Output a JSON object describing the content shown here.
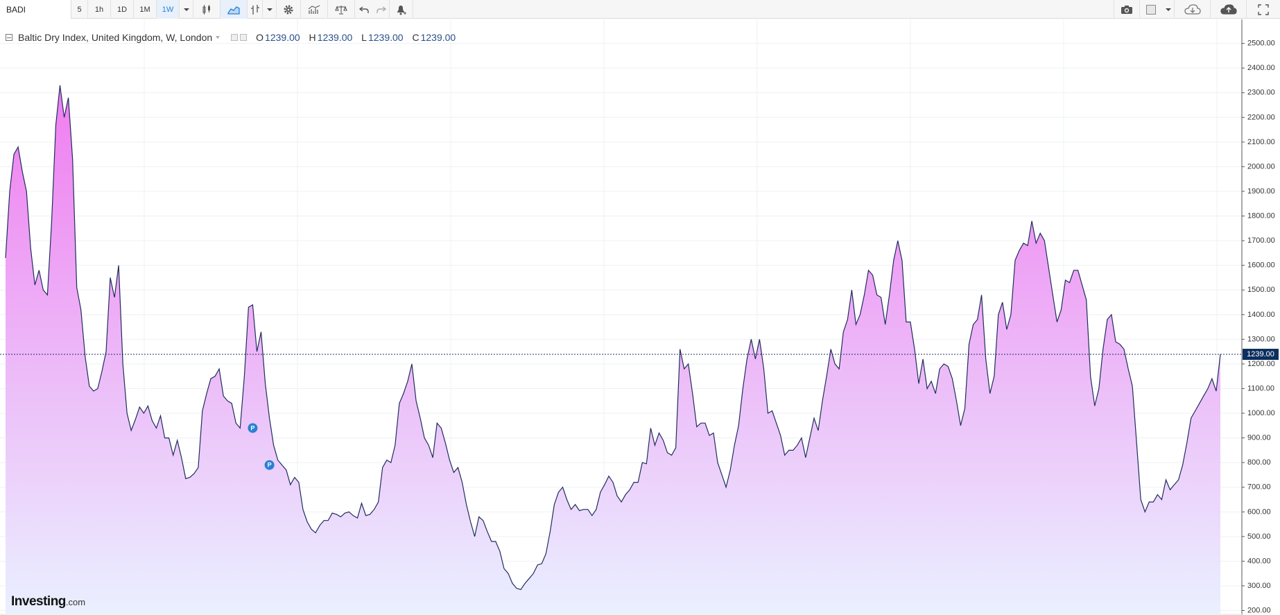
{
  "toolbar": {
    "symbol": "BADI",
    "intervals": [
      "5",
      "1h",
      "1D",
      "1M",
      "1W"
    ],
    "active_interval": "1W"
  },
  "legend": {
    "title": "Baltic Dry Index, United Kingdom, W, London",
    "open_label": "O",
    "open": "1239.00",
    "high_label": "H",
    "high": "1239.00",
    "low_label": "L",
    "low": "1239.00",
    "close_label": "C",
    "close": "1239.00"
  },
  "price_axis": {
    "last_price_label": "1239.00",
    "last_price_color": "#0d2f5f"
  },
  "branding": {
    "logo_main": "Investing",
    "logo_domain": ".com"
  },
  "colors": {
    "line": "#1f2d5c",
    "fill_top": "#f07cf0",
    "fill_bottom": "#eaf0ff",
    "accent": "#2a7fd4"
  },
  "chart_data": {
    "type": "area",
    "ylim": [
      200,
      2550
    ],
    "yticks": [
      200,
      300,
      400,
      500,
      600,
      700,
      800,
      900,
      1000,
      1100,
      1200,
      1300,
      1400,
      1500,
      1600,
      1700,
      1800,
      1900,
      2000,
      2100,
      2200,
      2300,
      2400,
      2500
    ],
    "last_value": 1239,
    "markers": [
      {
        "label": "P",
        "index": 59,
        "value": 940
      },
      {
        "label": "P",
        "index": 63,
        "value": 790
      }
    ],
    "values": [
      1630,
      1900,
      2050,
      2080,
      1980,
      1900,
      1670,
      1520,
      1580,
      1500,
      1480,
      1780,
      2170,
      2330,
      2200,
      2280,
      2030,
      1510,
      1420,
      1230,
      1110,
      1090,
      1100,
      1170,
      1250,
      1550,
      1470,
      1600,
      1200,
      1000,
      930,
      975,
      1025,
      1000,
      1030,
      970,
      940,
      990,
      900,
      900,
      830,
      890,
      820,
      735,
      740,
      755,
      780,
      1010,
      1080,
      1140,
      1150,
      1180,
      1070,
      1050,
      1040,
      960,
      940,
      1150,
      1430,
      1440,
      1250,
      1330,
      1120,
      980,
      870,
      810,
      790,
      770,
      710,
      740,
      720,
      610,
      560,
      530,
      515,
      545,
      565,
      565,
      595,
      590,
      580,
      595,
      600,
      585,
      575,
      635,
      585,
      590,
      610,
      640,
      780,
      810,
      800,
      870,
      1040,
      1080,
      1130,
      1200,
      1050,
      980,
      900,
      870,
      820,
      960,
      940,
      880,
      810,
      760,
      780,
      720,
      630,
      560,
      500,
      580,
      565,
      520,
      480,
      480,
      440,
      370,
      350,
      310,
      290,
      285,
      310,
      330,
      350,
      385,
      390,
      430,
      520,
      630,
      680,
      700,
      650,
      610,
      630,
      605,
      610,
      610,
      585,
      610,
      680,
      710,
      745,
      720,
      665,
      640,
      670,
      690,
      720,
      720,
      800,
      795,
      940,
      870,
      920,
      890,
      840,
      830,
      860,
      1260,
      1180,
      1200,
      1080,
      945,
      960,
      960,
      910,
      920,
      800,
      750,
      700,
      770,
      870,
      950,
      1100,
      1220,
      1300,
      1220,
      1300,
      1180,
      1000,
      1010,
      960,
      910,
      830,
      850,
      850,
      870,
      900,
      820,
      900,
      980,
      930,
      1050,
      1150,
      1260,
      1200,
      1180,
      1330,
      1380,
      1500,
      1360,
      1400,
      1480,
      1580,
      1560,
      1480,
      1470,
      1360,
      1480,
      1620,
      1700,
      1620,
      1370,
      1370,
      1260,
      1120,
      1220,
      1100,
      1130,
      1080,
      1180,
      1200,
      1190,
      1140,
      1050,
      950,
      1020,
      1280,
      1360,
      1380,
      1480,
      1220,
      1080,
      1150,
      1400,
      1450,
      1340,
      1400,
      1620,
      1660,
      1690,
      1680,
      1780,
      1690,
      1730,
      1700,
      1590,
      1480,
      1370,
      1420,
      1540,
      1530,
      1580,
      1580,
      1520,
      1460,
      1150,
      1030,
      1100,
      1260,
      1380,
      1400,
      1290,
      1280,
      1260,
      1180,
      1110,
      880,
      650,
      600,
      640,
      640,
      670,
      650,
      730,
      690,
      710,
      730,
      790,
      880,
      980,
      1010,
      1040,
      1070,
      1100,
      1140,
      1090,
      1239
    ]
  }
}
